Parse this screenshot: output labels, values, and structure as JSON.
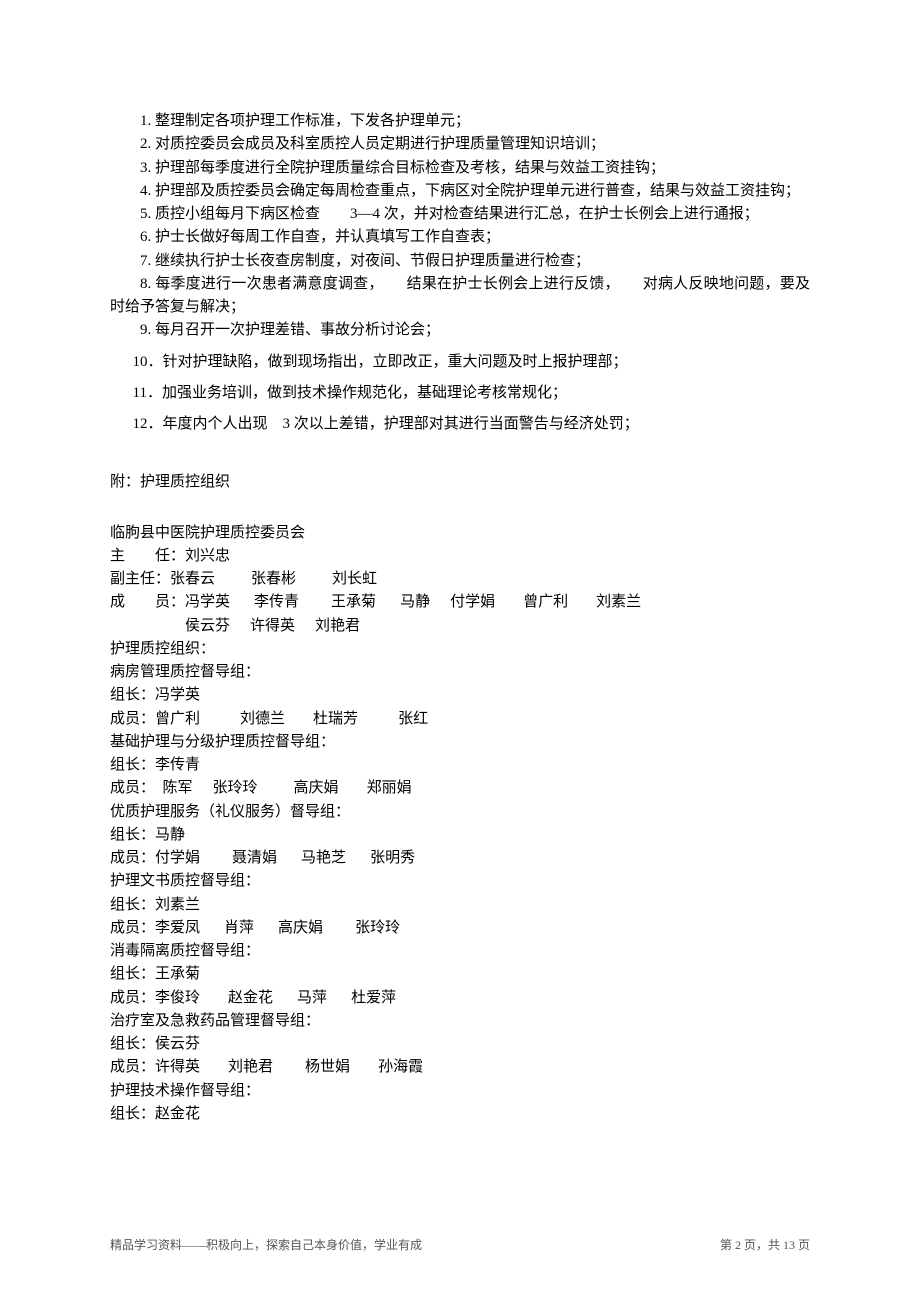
{
  "items": [
    "1. 整理制定各项护理工作标准，下发各护理单元；",
    "2. 对质控委员会成员及科室质控人员定期进行护理质量管理知识培训；",
    "3. 护理部每季度进行全院护理质量综合目标检查及考核，结果与效益工资挂钩；",
    "4. 护理部及质控委员会确定每周检查重点，下病区对全院护理单元进行普查，结果与效益工资挂钩；",
    "5. 质控小组每月下病区检查　　3—4 次，并对检查结果进行汇总，在护士长例会上进行通报；",
    "6. 护士长做好每周工作自查，并认真填写工作自查表；",
    "7. 继续执行护士长夜查房制度，对夜间、节假日护理质量进行检查；",
    "8. 每季度进行一次患者满意度调查，　　结果在护士长例会上进行反馈，　　对病人反映地问题，要及时给予答复与解决；",
    "9. 每月召开一次护理差错、事故分析讨论会；",
    "10．针对护理缺陷，做到现场指出，立即改正，重大问题及时上报护理部；",
    "11．加强业务培训，做到技术操作规范化，基础理论考核常规化；",
    "12．年度内个人出现　3 次以上差错，护理部对其进行当面警告与经济处罚；"
  ],
  "attach": "附：护理质控组织",
  "committee": {
    "title": "临朐县中医院护理质控委员会",
    "director_label": "主　　任：",
    "director": "刘兴忠",
    "deputy_label": "副主任：",
    "deputy": [
      "张春云",
      "张春彬",
      "刘长虹"
    ],
    "members_label": "成　　员：",
    "members_l1": [
      "冯学英",
      "李传青",
      "王承菊",
      "马静",
      "付学娟",
      "曾广利",
      "刘素兰"
    ],
    "members_l2": [
      "侯云芬",
      "许得英",
      "刘艳君"
    ]
  },
  "qc_org_label": "护理质控组织：",
  "groups": [
    {
      "title": "病房管理质控督导组：",
      "leader_label": "组长：",
      "leader": "冯学英",
      "members_label": "成员：",
      "members": [
        "曾广利",
        "刘德兰",
        "杜瑞芳",
        "张红"
      ]
    },
    {
      "title": "基础护理与分级护理质控督导组：",
      "leader_label": "组长：",
      "leader": "李传青",
      "members_label": "成员：　",
      "members": [
        "陈军",
        "张玲玲",
        "高庆娟",
        "郑丽娟"
      ]
    },
    {
      "title": "优质护理服务（礼仪服务）督导组：",
      "leader_label": "组长：",
      "leader": "马静",
      "members_label": "成员：",
      "members": [
        "付学娟",
        "聂清娟",
        "马艳芝",
        "张明秀"
      ]
    },
    {
      "title": "护理文书质控督导组：",
      "leader_label": "组长：",
      "leader": "刘素兰",
      "members_label": "成员：",
      "members": [
        "李爱凤",
        "肖萍",
        "高庆娟",
        "张玲玲"
      ]
    },
    {
      "title": "消毒隔离质控督导组：",
      "leader_label": "组长：",
      "leader": "王承菊",
      "members_label": "成员：",
      "members": [
        "李俊玲",
        "赵金花",
        "马萍",
        "杜爱萍"
      ]
    },
    {
      "title": "治疗室及急救药品管理督导组：",
      "leader_label": "组长：",
      "leader": "侯云芬",
      "members_label": "成员：",
      "members": [
        "许得英",
        "刘艳君",
        "杨世娟",
        "孙海霞"
      ]
    },
    {
      "title": "护理技术操作督导组：",
      "leader_label": "组长：",
      "leader": "赵金花",
      "members_label": "",
      "members": []
    }
  ],
  "footer": {
    "left": "精品学习资料——积极向上，探索自己本身价值，学业有成",
    "right": "第 2 页，共 13 页"
  },
  "spacing": {
    "deputy": [
      36,
      36,
      0
    ],
    "members_l1": [
      24,
      32,
      24,
      20,
      28,
      28,
      0
    ],
    "members_l2": [
      20,
      20,
      0
    ],
    "group_members": [
      [
        40,
        28,
        40,
        0
      ],
      [
        20,
        36,
        28,
        0
      ],
      [
        32,
        24,
        24,
        0
      ],
      [
        24,
        24,
        32,
        0
      ],
      [
        28,
        24,
        24,
        0
      ],
      [
        28,
        32,
        28,
        0
      ],
      []
    ]
  }
}
